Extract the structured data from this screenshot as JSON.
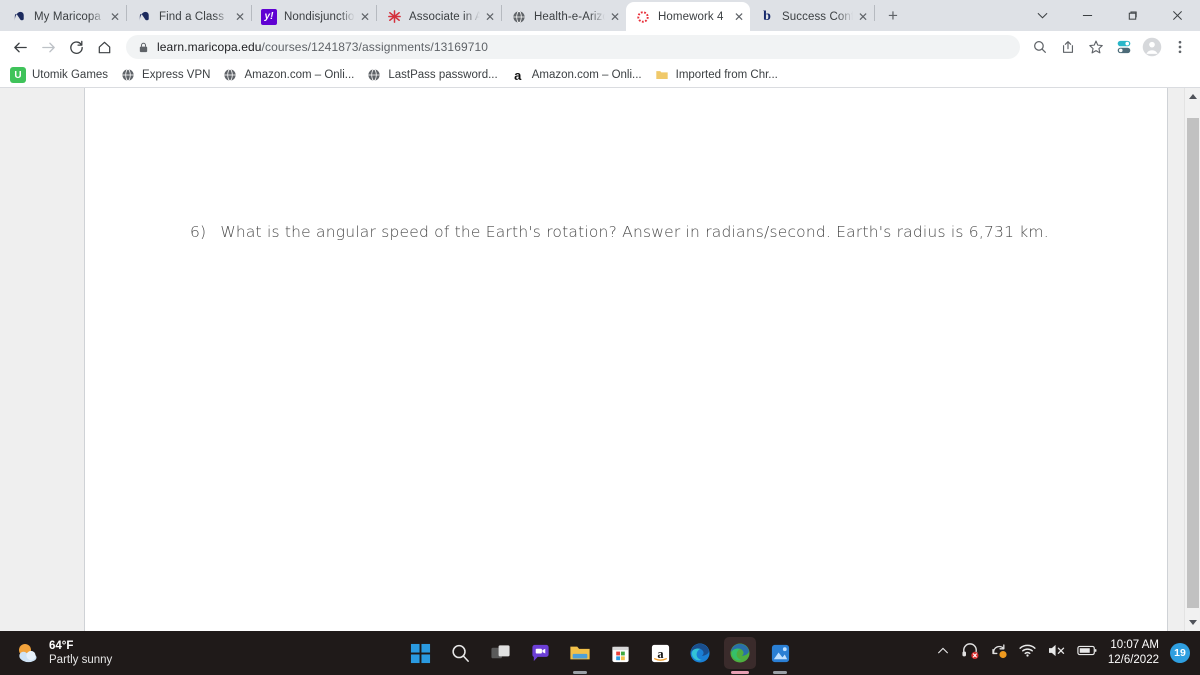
{
  "browser": {
    "tabs": [
      {
        "title": "My Maricopa | M",
        "favicon": "maricopa-icon",
        "active": false
      },
      {
        "title": "Find a Class",
        "favicon": "maricopa-icon",
        "active": false
      },
      {
        "title": "Nondisjunction o",
        "favicon": "yahoo-icon",
        "active": false
      },
      {
        "title": "Associate in Arts,",
        "favicon": "starburst-icon",
        "active": false
      },
      {
        "title": "Health-e-Arizona",
        "favicon": "globe-icon",
        "active": false
      },
      {
        "title": "Homework 4",
        "favicon": "canvas-loading-icon",
        "active": true
      },
      {
        "title": "Success Confirma",
        "favicon": "b-icon",
        "active": false
      }
    ],
    "new_tab_label": "+",
    "tab_close_label": "✕",
    "tab_search_label": "∨",
    "window_controls": {
      "minimize": "—",
      "maximize": "❐",
      "close": "✕"
    },
    "toolbar": {
      "back_label": "←",
      "forward_label": "→",
      "reload_label": "C",
      "home_label": "⌂",
      "url_host": "learn.maricopa.edu",
      "url_path": "/courses/1241873/assignments/13169710",
      "url_full": "learn.maricopa.edu/courses/1241873/assignments/13169710",
      "lock_icon": "lock-icon",
      "zoom_icon": "search-icon",
      "share_icon": "share-icon",
      "bookmark_icon": "star-icon",
      "extension_icon": "extension-icon",
      "profile_icon": "profile-avatar-icon",
      "menu_icon": "three-dot-menu-icon"
    },
    "bookmarks": [
      {
        "label": "Utomik Games",
        "favicon": "utomik-icon"
      },
      {
        "label": "Express VPN",
        "favicon": "globe-icon"
      },
      {
        "label": "Amazon.com – Onli...",
        "favicon": "globe-icon"
      },
      {
        "label": "LastPass password...",
        "favicon": "globe-icon"
      },
      {
        "label": "Amazon.com – Onli...",
        "favicon": "amazon-icon"
      },
      {
        "label": "Imported from Chr...",
        "favicon": "folder-icon"
      }
    ]
  },
  "page": {
    "question_number": "6)",
    "question_text": "What is the angular speed of the Earth's rotation? Answer in radians/second. Earth's radius is 6,731 km."
  },
  "scrollbar": {
    "up_arrow": "scroll-up-arrow",
    "down_arrow": "scroll-down-arrow"
  },
  "taskbar": {
    "weather": {
      "temperature": "64°F",
      "condition": "Partly sunny",
      "icon": "partly-sunny-icon"
    },
    "apps": [
      {
        "name": "start-button",
        "icon": "windows-logo-icon"
      },
      {
        "name": "search-button",
        "icon": "search-icon"
      },
      {
        "name": "task-view-button",
        "icon": "task-view-icon"
      },
      {
        "name": "chat-button",
        "icon": "teams-chat-icon"
      },
      {
        "name": "file-explorer-button",
        "icon": "folder-icon"
      },
      {
        "name": "microsoft-store-button",
        "icon": "store-icon"
      },
      {
        "name": "amazon-app-button",
        "icon": "amazon-icon"
      },
      {
        "name": "edge-button",
        "icon": "edge-icon"
      },
      {
        "name": "edge-active-button",
        "icon": "edge-dev-icon"
      },
      {
        "name": "photos-button",
        "icon": "photos-icon"
      }
    ],
    "tray": {
      "overflow_icon": "chevron-up-icon",
      "headset_icon": "headset-muted-icon",
      "sync_icon": "sync-pending-icon",
      "wifi_icon": "wifi-icon",
      "volume_icon": "volume-muted-icon",
      "battery_icon": "battery-icon",
      "time": "10:07 AM",
      "date": "12/6/2022",
      "notification_count": "19"
    }
  }
}
